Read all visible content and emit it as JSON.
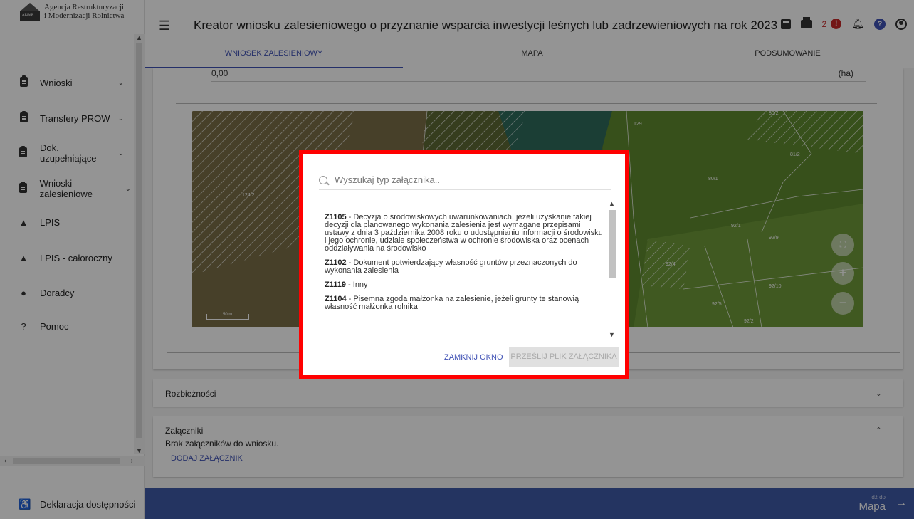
{
  "brand": {
    "line1": "Agencja Restrukturyzacji",
    "line2": "i Modernizacji Rolnictwa",
    "logo_text": "ARiMR"
  },
  "sidebar": {
    "items": [
      {
        "label": "Wnioski",
        "icon": "clipboard-icon",
        "chevron": "⌄"
      },
      {
        "label": "Transfery PROW",
        "icon": "clipboard-icon",
        "chevron": "⌄"
      },
      {
        "label": "Dok. uzupełniające",
        "icon": "clipboard-icon",
        "chevron": "⌄"
      },
      {
        "label": "Wnioski zalesieniowe",
        "icon": "clipboard-icon",
        "chevron": "⌄"
      },
      {
        "label": "LPIS",
        "icon": "mountain-icon"
      },
      {
        "label": "LPIS - całoroczny",
        "icon": "mountain-icon"
      },
      {
        "label": "Doradcy",
        "icon": "person-icon"
      },
      {
        "label": "Pomoc",
        "icon": "help-icon"
      }
    ],
    "accessibility": "Deklaracja dostępności"
  },
  "header": {
    "title": "Kreator wniosku zalesieniowego o przyznanie wsparcia inwestycji leśnych lub zadrzewieniowych na rok 2023",
    "alert_count": "2",
    "alert_symbol": "!",
    "help_symbol": "?"
  },
  "tabs": [
    "WNIOSEK ZALESIENIOWY",
    "MAPA",
    "PODSUMOWANIE"
  ],
  "area": {
    "value": "0,00",
    "unit": "(ha)"
  },
  "map": {
    "parcels": [
      "124/2",
      "129",
      "80/2",
      "81/2",
      "80/1",
      "92/1",
      "92/9",
      "92/4",
      "92/10",
      "92/5",
      "92/2"
    ],
    "scale": "50 m"
  },
  "sections": {
    "rozbieznosci": "Rozbieżności",
    "zalaczniki": "Załączniki",
    "zalaczniki_empty": "Brak załączników do wniosku.",
    "add_attachment": "DODAJ ZAŁĄCZNIK"
  },
  "bottom": {
    "small": "Idź do",
    "big": "Mapa"
  },
  "dialog": {
    "search_placeholder": "Wyszukaj typ załącznika..",
    "options": [
      {
        "code": "Z1105",
        "text": " - Decyzja o środowiskowych uwarunkowaniach, jeżeli uzyskanie takiej decyzji dla planowanego wykonania zalesienia jest wymagane przepisami ustawy z dnia 3 października 2008 roku o udostępnianiu informacji o środowisku i jego ochronie, udziale społeczeństwa w ochronie środowiska oraz ocenach oddziaływania na środowisko"
      },
      {
        "code": "Z1102",
        "text": " - Dokument potwierdzający własność gruntów przeznaczonych do wykonania zalesienia"
      },
      {
        "code": "Z1119",
        "text": " - Inny"
      },
      {
        "code": "Z1104",
        "text": " - Pisemna zgoda małżonka na zalesienie, jeżeli grunty te stanowią własność małżonka rolnika"
      }
    ],
    "close_label": "ZAMKNIJ OKNO",
    "send_label": "PRZEŚLIJ PLIK ZAŁĄCZNIKA"
  },
  "colors": {
    "accent": "#3f51b5",
    "bottom_bar": "#3f5aa8",
    "highlight_frame": "#ff0000",
    "alert": "#c62828"
  }
}
